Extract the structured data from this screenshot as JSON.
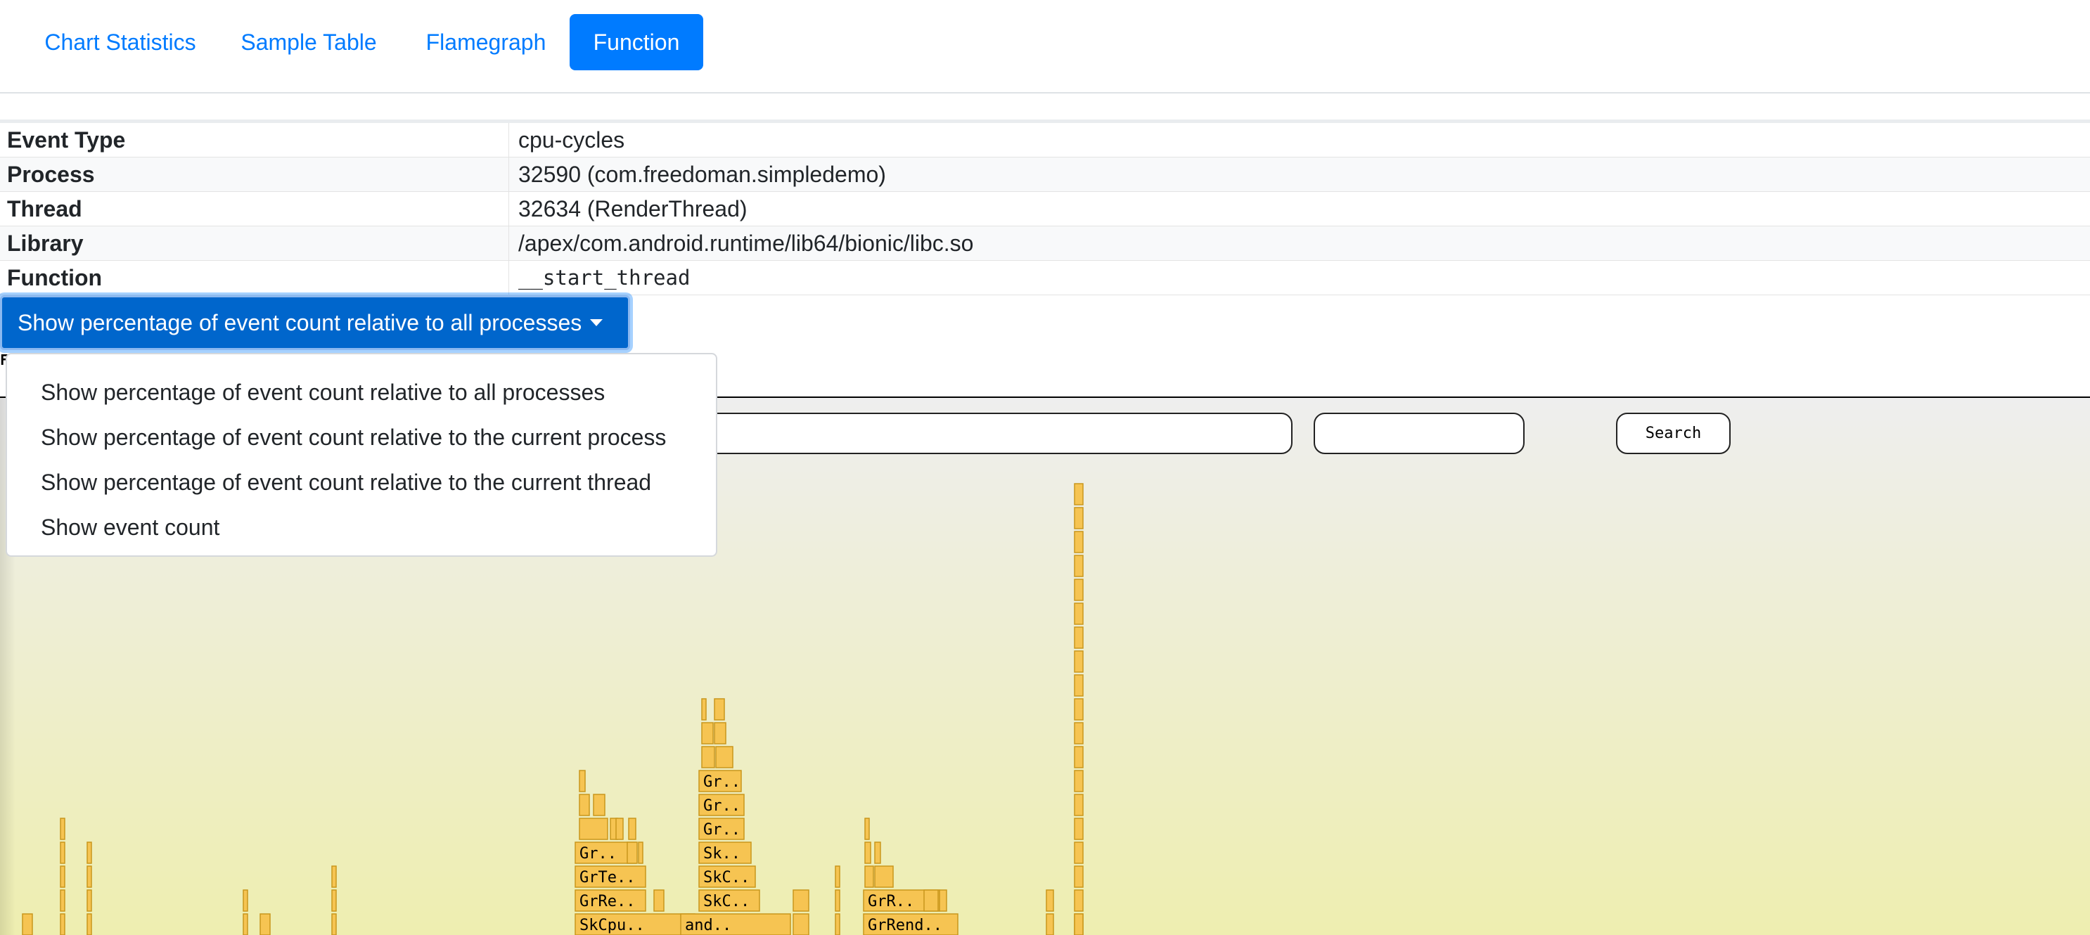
{
  "tabs": [
    {
      "label": "Chart Statistics",
      "active": false
    },
    {
      "label": "Sample Table",
      "active": false
    },
    {
      "label": "Flamegraph",
      "active": false
    },
    {
      "label": "Function",
      "active": true
    }
  ],
  "info": {
    "rows": [
      {
        "key": "Event Type",
        "value": "cpu-cycles"
      },
      {
        "key": "Process",
        "value": "32590 (com.freedoman.simpledemo)"
      },
      {
        "key": "Thread",
        "value": "32634 (RenderThread)"
      },
      {
        "key": "Library",
        "value": "/apex/com.android.runtime/lib64/bionic/libc.so"
      },
      {
        "key": "Function",
        "value": "__start_thread"
      }
    ]
  },
  "dropdown": {
    "selected": "Show percentage of event count relative to all processes",
    "options": [
      "Show percentage of event count relative to all processes",
      "Show percentage of event count relative to the current process",
      "Show percentage of event count relative to the current thread",
      "Show event count"
    ]
  },
  "flamegraph": {
    "search_button": "Search",
    "search_placeholder": "",
    "peek_text": "F",
    "colors": {
      "frame_fill": "#f6c452",
      "frame_stroke": "#c9961c",
      "bg_top": "#eeeeee",
      "bg_bottom": "#eeeeb0"
    },
    "frame_labels": [
      "Gr..",
      "GrTe..",
      "GrRe..",
      "SkCpu..",
      "Gr..",
      "Gr..",
      "Gr..",
      "Sk..",
      "SkC..",
      "SkC..",
      "and..",
      "GrR..",
      "GrRend.."
    ]
  }
}
